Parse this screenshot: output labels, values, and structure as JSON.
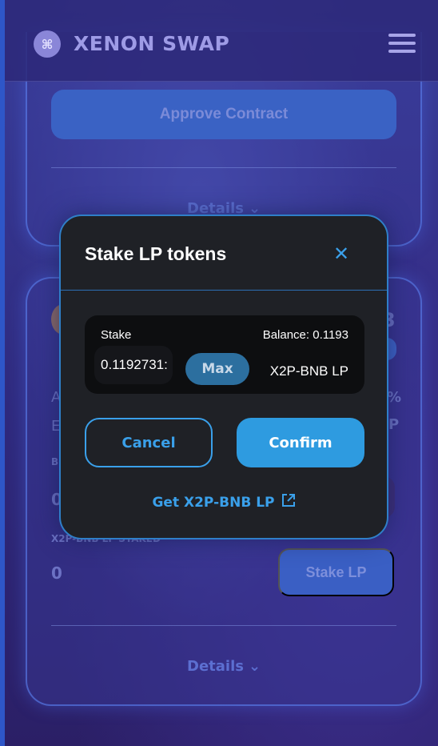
{
  "header": {
    "brand": "XENON SWAP",
    "logo_glyph": "⌘",
    "menu_icon": "hamburger-icon"
  },
  "card1": {
    "approve_label": "Approve Contract",
    "details_label": "Details",
    "details_icon": "chevron-down-icon"
  },
  "card2": {
    "row_a": "A",
    "row_e": "E",
    "right_a": "%",
    "right_e": "P",
    "small_label": "B",
    "zero_value_top": "0",
    "staked_label": "X2P-BNB LP STAKED",
    "staked_value": "0",
    "corner_char": "3",
    "stake_lp_label": "Stake LP",
    "details_label": "Details"
  },
  "modal": {
    "title": "Stake LP tokens",
    "close_icon": "close-icon",
    "stake_label": "Stake",
    "balance_label": "Balance: 0.1193",
    "amount_value": "0.1192731:",
    "max_label": "Max",
    "token_label": "X2P-BNB LP",
    "cancel_label": "Cancel",
    "confirm_label": "Confirm",
    "get_link_label": "Get X2P-BNB LP",
    "external_icon": "external-link-icon"
  },
  "colors": {
    "accent": "#3aa0ea",
    "modal_bg": "#1f2126",
    "page_bg": "#2f2a7e"
  }
}
